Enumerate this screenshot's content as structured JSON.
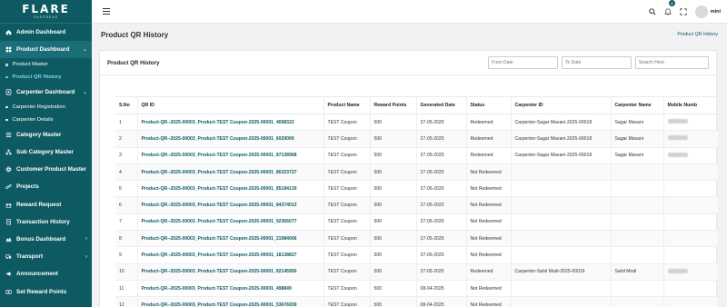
{
  "brand": {
    "name": "FLARE",
    "tagline": "OVERSEAS"
  },
  "sidebar": {
    "items": [
      {
        "label": "Admin Dashboard",
        "icon": "home-icon",
        "type": "main"
      },
      {
        "label": "Product Dashboard",
        "icon": "grid-icon",
        "type": "main",
        "chevron": "⌄",
        "active": true
      },
      {
        "label": "Product Master",
        "type": "sub"
      },
      {
        "label": "Product QR History",
        "type": "sub",
        "current": true
      },
      {
        "label": "Carpenter Dashboard",
        "icon": "user-badge-icon",
        "type": "main",
        "chevron": "⌄"
      },
      {
        "label": "Carpenter Registration",
        "type": "sub"
      },
      {
        "label": "Carpenter Details",
        "type": "sub"
      },
      {
        "label": "Category Master",
        "icon": "list-icon",
        "type": "main"
      },
      {
        "label": "Sub Category Master",
        "icon": "sitemap-icon",
        "type": "main"
      },
      {
        "label": "Customer Product Master",
        "icon": "gear-icon",
        "type": "main"
      },
      {
        "label": "Projects",
        "icon": "link-icon",
        "type": "main"
      },
      {
        "label": "Reward Request",
        "icon": "gift-icon",
        "type": "main"
      },
      {
        "label": "Transaction History",
        "icon": "receipt-icon",
        "type": "main"
      },
      {
        "label": "Bonus Dashboard",
        "icon": "bonus-icon",
        "type": "main",
        "chevron": "›"
      },
      {
        "label": "Transport",
        "icon": "truck-icon",
        "type": "main",
        "chevron": "›"
      },
      {
        "label": "Announcement",
        "icon": "megaphone-icon",
        "type": "main"
      },
      {
        "label": "Set Reward Points",
        "icon": "points-icon",
        "type": "main"
      }
    ]
  },
  "topbar": {
    "notification_count": "10",
    "user_name": "mini"
  },
  "page": {
    "title": "Product QR History",
    "breadcrumb": "Product QR History"
  },
  "card": {
    "title": "Product QR History",
    "from_date_placeholder": "From Date",
    "to_date_placeholder": "To Date",
    "search_placeholder": "Search Here"
  },
  "table": {
    "headers": [
      "S.No",
      "QR ID",
      "Product Name",
      "Reward Points",
      "Generated Date",
      "Status",
      "Carpenter ID",
      "Carpenter Name",
      "Mobile Numb"
    ],
    "rows": [
      [
        "1",
        "Product-QR--2025-00003_Product-TEST Coupon-2025-00001_4698322",
        "TEST Coupon",
        "500",
        "27-05-2025",
        "Redeemed",
        "Carpenter-Sagar Mavani-2025-00018",
        "Sagar Mavani",
        "masked"
      ],
      [
        "2",
        "Product-QR--2025-00003_Product-TEST Coupon-2025-00001_6020000",
        "TEST Coupon",
        "500",
        "27-05-2025",
        "Redeemed",
        "Carpenter-Sagar Mavani-2025-00018",
        "Sagar Mavani",
        "masked"
      ],
      [
        "3",
        "Product-QR--2025-00003_Product-TEST Coupon-2025-00001_87138968",
        "TEST Coupon",
        "500",
        "27-05-2025",
        "Redeemed",
        "Carpenter-Sagar Mavani-2025-00018",
        "Sagar Mavani",
        "masked"
      ],
      [
        "4",
        "Product-QR--2025-00003_Product-TEST Coupon-2025-00001_86323727",
        "TEST Coupon",
        "500",
        "27-05-2025",
        "Not Redeemed",
        "",
        "",
        ""
      ],
      [
        "5",
        "Product-QR--2025-00003_Product-TEST Coupon-2025-00001_85184130",
        "TEST Coupon",
        "500",
        "27-05-2025",
        "Not Redeemed",
        "",
        "",
        ""
      ],
      [
        "6",
        "Product-QR--2025-00003_Product-TEST Coupon-2025-00001_84374013",
        "TEST Coupon",
        "500",
        "27-05-2025",
        "Not Redeemed",
        "",
        "",
        ""
      ],
      [
        "7",
        "Product-QR--2025-00003_Product-TEST Coupon-2025-00001_92365077",
        "TEST Coupon",
        "500",
        "27-05-2025",
        "Not Redeemed",
        "",
        "",
        ""
      ],
      [
        "8",
        "Product-QR--2025-00003_Product-TEST Coupon-2025-00001_21984006",
        "TEST Coupon",
        "500",
        "27-05-2025",
        "Not Redeemed",
        "",
        "",
        ""
      ],
      [
        "9",
        "Product-QR--2025-00003_Product-TEST Coupon-2025-00001_18138827",
        "TEST Coupon",
        "500",
        "27-05-2025",
        "Not Redeemed",
        "",
        "",
        ""
      ],
      [
        "10",
        "Product-QR--2025-00003_Product-TEST Coupon-2025-00001_82145950",
        "TEST Coupon",
        "500",
        "27-05-2025",
        "Redeemed",
        "Carpenter-Sahil Modi-2025-00019",
        "Sahil Modi",
        "masked"
      ],
      [
        "11",
        "Product-QR--2025-00003_Product-TEST Coupon-2025-00001_498849",
        "TEST Coupon",
        "500",
        "08-04-2025",
        "Not Redeemed",
        "",
        "",
        ""
      ],
      [
        "12",
        "Product-QR--2025-00003_Product-TEST Coupon-2025-00001_53676939",
        "TEST Coupon",
        "500",
        "08-04-2025",
        "Not Redeemed",
        "",
        "",
        ""
      ]
    ]
  },
  "colors": {
    "sidebar_bg": "#0e5a63",
    "accent": "#0e5a63",
    "active_sub": "#7fd6e3",
    "page_bg": "#f1f2f4"
  }
}
